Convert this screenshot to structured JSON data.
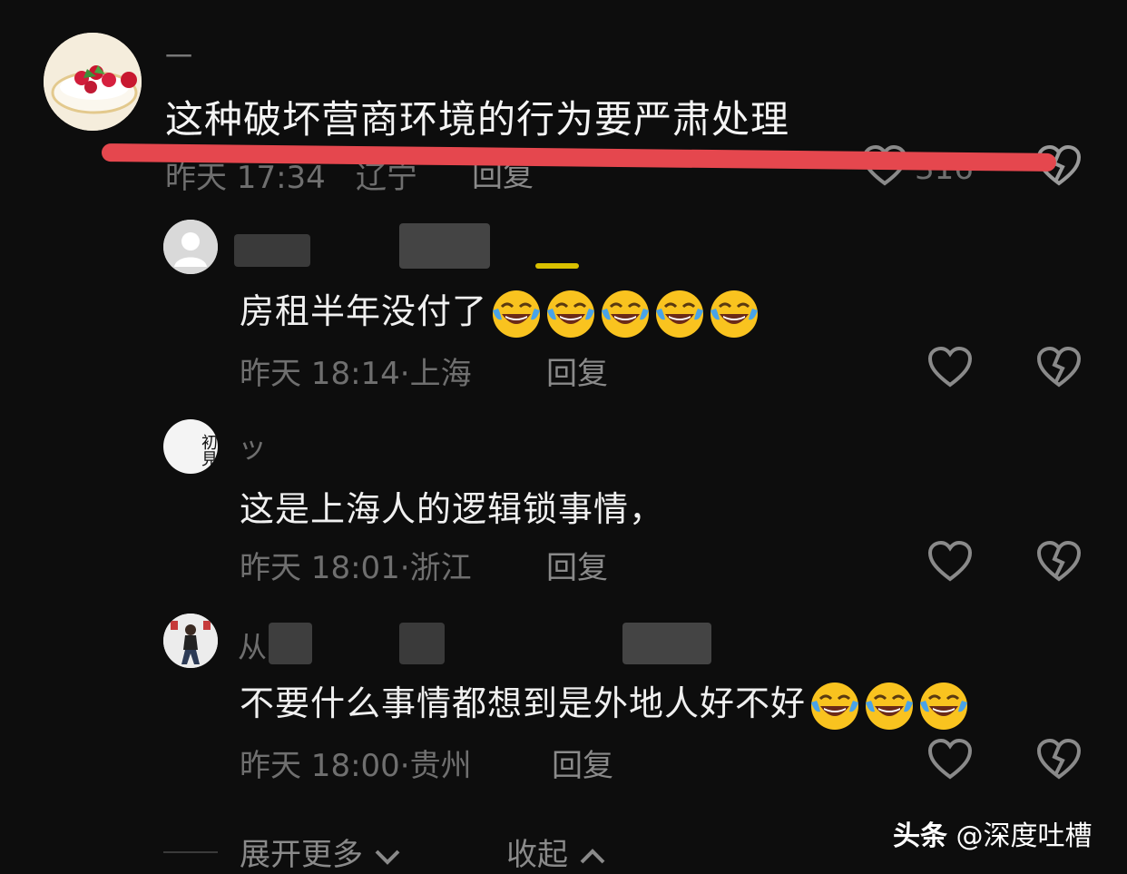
{
  "main_comment": {
    "username": "一",
    "text": "这种破坏营商环境的行为要严肃处理",
    "time": "昨天 17:34",
    "location": "辽宁",
    "reply_label": "回复",
    "likes": "316"
  },
  "replies": [
    {
      "username": "",
      "text": "房租半年没付了",
      "emoji_count": 5,
      "time": "昨天 18:14",
      "location": "上海",
      "reply_label": "回复"
    },
    {
      "username": "ッ",
      "avatar_text": "初見",
      "text": "这是上海人的逻辑锁事情，",
      "time": "昨天 18:01",
      "location": "浙江",
      "reply_label": "回复"
    },
    {
      "username": "从",
      "text": "不要什么事情都想到是外地人好不好",
      "emoji_count": 3,
      "time": "昨天 18:00",
      "location": "贵州",
      "reply_label": "回复"
    }
  ],
  "footer": {
    "expand_label": "展开更多",
    "collapse_label": "收起"
  },
  "watermark": {
    "brand": "头条",
    "account": "@深度吐槽"
  },
  "colors": {
    "background": "#0d0d0d",
    "strike": "#e5474e",
    "meta": "#6f6f6f"
  }
}
